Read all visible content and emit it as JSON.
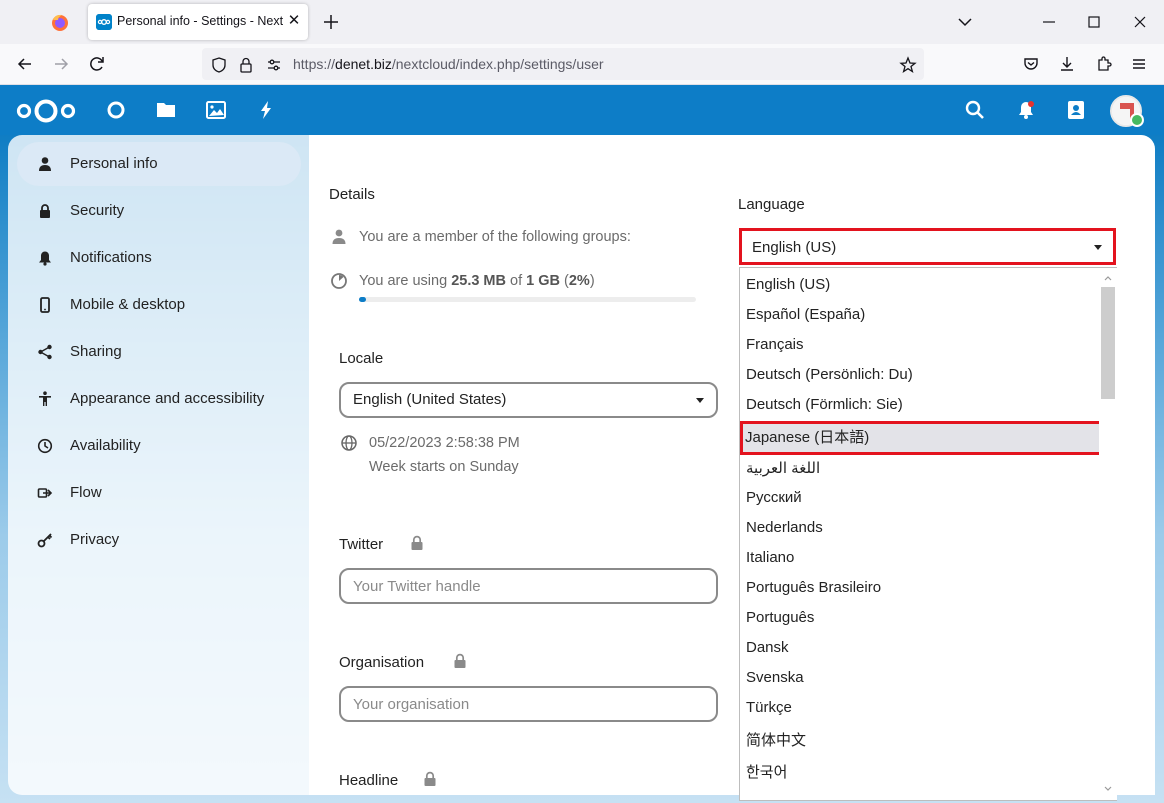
{
  "browser": {
    "tab_title": "Personal info - Settings - Nextcloud",
    "tab_close": "✕",
    "url_prefix": "https://",
    "url_domain": "denet.biz",
    "url_path": "/nextcloud/index.php/settings/user"
  },
  "sidebar": {
    "items": [
      {
        "label": "Personal info",
        "icon": "user-icon",
        "active": true
      },
      {
        "label": "Security",
        "icon": "lock-icon"
      },
      {
        "label": "Notifications",
        "icon": "bell-icon"
      },
      {
        "label": "Mobile & desktop",
        "icon": "phone-icon"
      },
      {
        "label": "Sharing",
        "icon": "share-icon"
      },
      {
        "label": "Appearance and accessibility",
        "icon": "accessibility-icon"
      },
      {
        "label": "Availability",
        "icon": "clock-icon"
      },
      {
        "label": "Flow",
        "icon": "flow-icon"
      },
      {
        "label": "Privacy",
        "icon": "key-icon"
      }
    ]
  },
  "details": {
    "title": "Details",
    "groups_text": "You are a member of the following groups:",
    "usage_prefix": "You are using ",
    "usage_used": "25.3 MB",
    "usage_of": " of ",
    "usage_total": "1 GB",
    "usage_open": " (",
    "usage_pct": "2%",
    "usage_close": ")",
    "usage_fraction": 0.02
  },
  "locale": {
    "title": "Locale",
    "value": "English (United States)",
    "datetime": "05/22/2023 2:58:38 PM",
    "week_start": "Week starts on Sunday"
  },
  "twitter": {
    "title": "Twitter",
    "placeholder": "Your Twitter handle"
  },
  "organisation": {
    "title": "Organisation",
    "placeholder": "Your organisation"
  },
  "headline": {
    "title": "Headline"
  },
  "language": {
    "title": "Language",
    "value": "English (US)",
    "options": [
      "English (US)",
      "Español (España)",
      "Français",
      "Deutsch (Persönlich: Du)",
      "Deutsch (Förmlich: Sie)",
      "Japanese (日本語)",
      "اللغة العربية",
      "Русский",
      "Nederlands",
      "Italiano",
      "Português Brasileiro",
      "Português",
      "Dansk",
      "Svenska",
      "Türkçe",
      "简体中文",
      "한국어"
    ],
    "highlighted": "Japanese (日本語)"
  },
  "colors": {
    "brand": "#0d7dc7",
    "highlight_border": "#e3131e",
    "status_online": "#46ba61"
  }
}
